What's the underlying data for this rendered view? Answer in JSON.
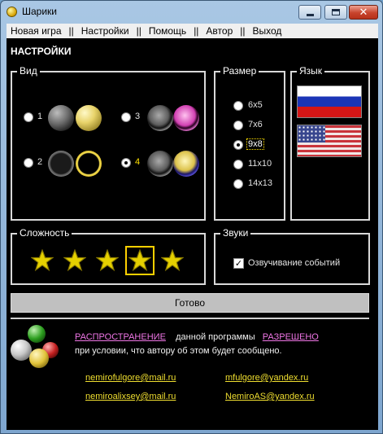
{
  "window": {
    "title": "Шарики",
    "controls": {
      "minimize": "minimize-icon",
      "maximize": "maximize-icon",
      "close": "close-icon"
    }
  },
  "menu": {
    "items": [
      "Новая игра",
      "Настройки",
      "Помощь",
      "Автор",
      "Выход"
    ],
    "separator": "||"
  },
  "settings": {
    "heading": "НАСТРОЙКИ",
    "view": {
      "label": "Вид",
      "options": [
        {
          "label": "1",
          "selected": false
        },
        {
          "label": "2",
          "selected": false
        },
        {
          "label": "3",
          "selected": false
        },
        {
          "label": "4",
          "selected": true
        }
      ]
    },
    "size": {
      "label": "Размер",
      "options": [
        {
          "label": "6x5",
          "selected": false
        },
        {
          "label": "7x6",
          "selected": false
        },
        {
          "label": "9x8",
          "selected": true
        },
        {
          "label": "11x10",
          "selected": false
        },
        {
          "label": "14x13",
          "selected": false
        }
      ]
    },
    "language": {
      "label": "Язык",
      "options": [
        "russian-flag-icon",
        "usa-flag-icon"
      ]
    },
    "difficulty": {
      "label": "Сложность",
      "stars": 5,
      "selected_star": 4
    },
    "sounds": {
      "label": "Звуки",
      "checkbox_label": "Озвучивание событий",
      "checked": true
    },
    "done_label": "Готово"
  },
  "info": {
    "line1_link1": "РАСПРОСТРАНЕНИЕ",
    "line1_text": "данной программы",
    "line1_link2": "РАЗРЕШЕНО",
    "line2": "при условии, что автору об этом будет сообщено.",
    "emails": [
      "nemirofulgore@mail.ru",
      "mfulgore@yandex.ru",
      "nemiroalixsey@mail.ru",
      "NemiroAS@yandex.ru"
    ]
  },
  "colors": {
    "accent_star": "#e5d000",
    "selection": "#ffd000",
    "link_pink": "#f076e6",
    "email_yellow": "#f0df30"
  }
}
